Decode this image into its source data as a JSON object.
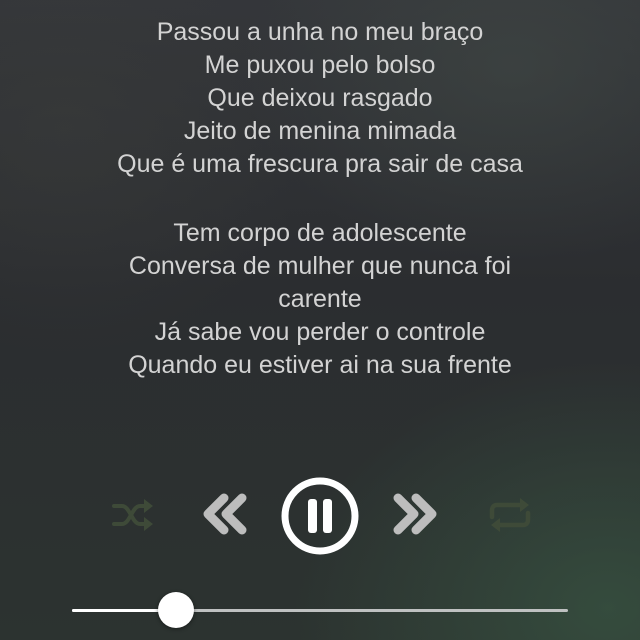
{
  "lyrics": {
    "stanza1": [
      "Passou a unha no meu braço",
      "Me puxou pelo bolso",
      "Que deixou rasgado",
      "Jeito de menina mimada",
      "Que é uma frescura pra sair de casa"
    ],
    "stanza2": [
      "Tem corpo de adolescente",
      "Conversa de mulher que nunca foi",
      "carente",
      "Já sabe vou perder o controle",
      "Quando eu estiver ai na sua frente"
    ]
  },
  "controls": {
    "shuffle_icon": "shuffle-icon",
    "previous_icon": "rewind-icon",
    "pause_icon": "pause-icon",
    "next_icon": "fast-forward-icon",
    "repeat_icon": "repeat-icon",
    "toggle_color": "#3e4a38",
    "skip_color": "#bdbdbd",
    "pause_color": "#ffffff"
  },
  "progress": {
    "fraction": 0.21
  }
}
